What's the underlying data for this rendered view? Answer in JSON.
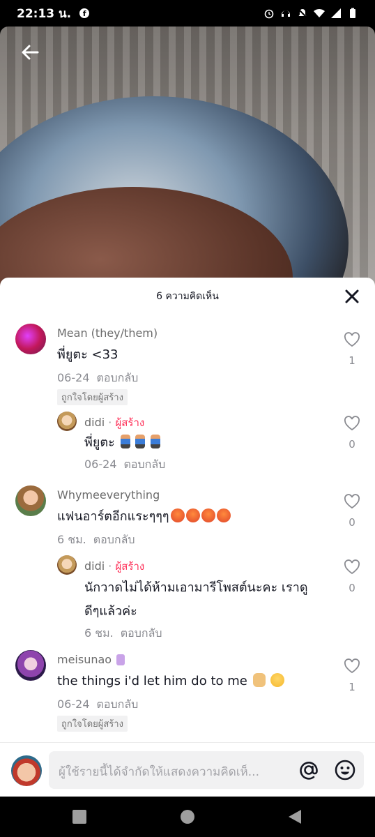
{
  "status_bar": {
    "time": "22:13 น."
  },
  "sheet": {
    "title": "6 ความคิดเห็น"
  },
  "comments": [
    {
      "username": "Mean (they/them)",
      "text": "พี่ยูตะ <33",
      "date": "06-24",
      "reply_label": "ตอบกลับ",
      "liked_by_creator": "ถูกใจโดยผู้สร้าง",
      "likes": "1",
      "replies": [
        {
          "username": "didi",
          "separator": "·",
          "creator_label": "ผู้สร้าง",
          "text": "พี่ยูตะ",
          "date": "06-24",
          "reply_label": "ตอบกลับ",
          "likes": "0"
        }
      ]
    },
    {
      "username": "Whymeeverything",
      "text": "แฟนอาร์ตอีกแระๆๆๆ",
      "date": "6 ชม.",
      "reply_label": "ตอบกลับ",
      "likes": "0",
      "replies": [
        {
          "username": "didi",
          "separator": "·",
          "creator_label": "ผู้สร้าง",
          "text_line1": "นักวาดไม่ได้ห้ามเอามารีโพสต์นะคะ เราดู",
          "text_line2": "ดีๆแล้วค่ะ",
          "date": "6 ชม.",
          "reply_label": "ตอบกลับ",
          "likes": "0"
        }
      ]
    },
    {
      "username": "meisunao",
      "text": "the things i'd let him do to me",
      "date": "06-24",
      "reply_label": "ตอบกลับ",
      "liked_by_creator": "ถูกใจโดยผู้สร้าง",
      "likes": "1"
    }
  ],
  "input": {
    "placeholder": "ผู้ใช้รายนี้ได้จำกัดให้แสดงความคิดเห็..."
  },
  "icons": {
    "back": "arrow-left-icon",
    "close": "close-icon",
    "like": "heart-outline-icon",
    "mention": "at-icon",
    "emoji": "smile-icon"
  },
  "colors": {
    "creator": "#fe2c55",
    "text": "#161823",
    "muted": "#8a8b91"
  }
}
